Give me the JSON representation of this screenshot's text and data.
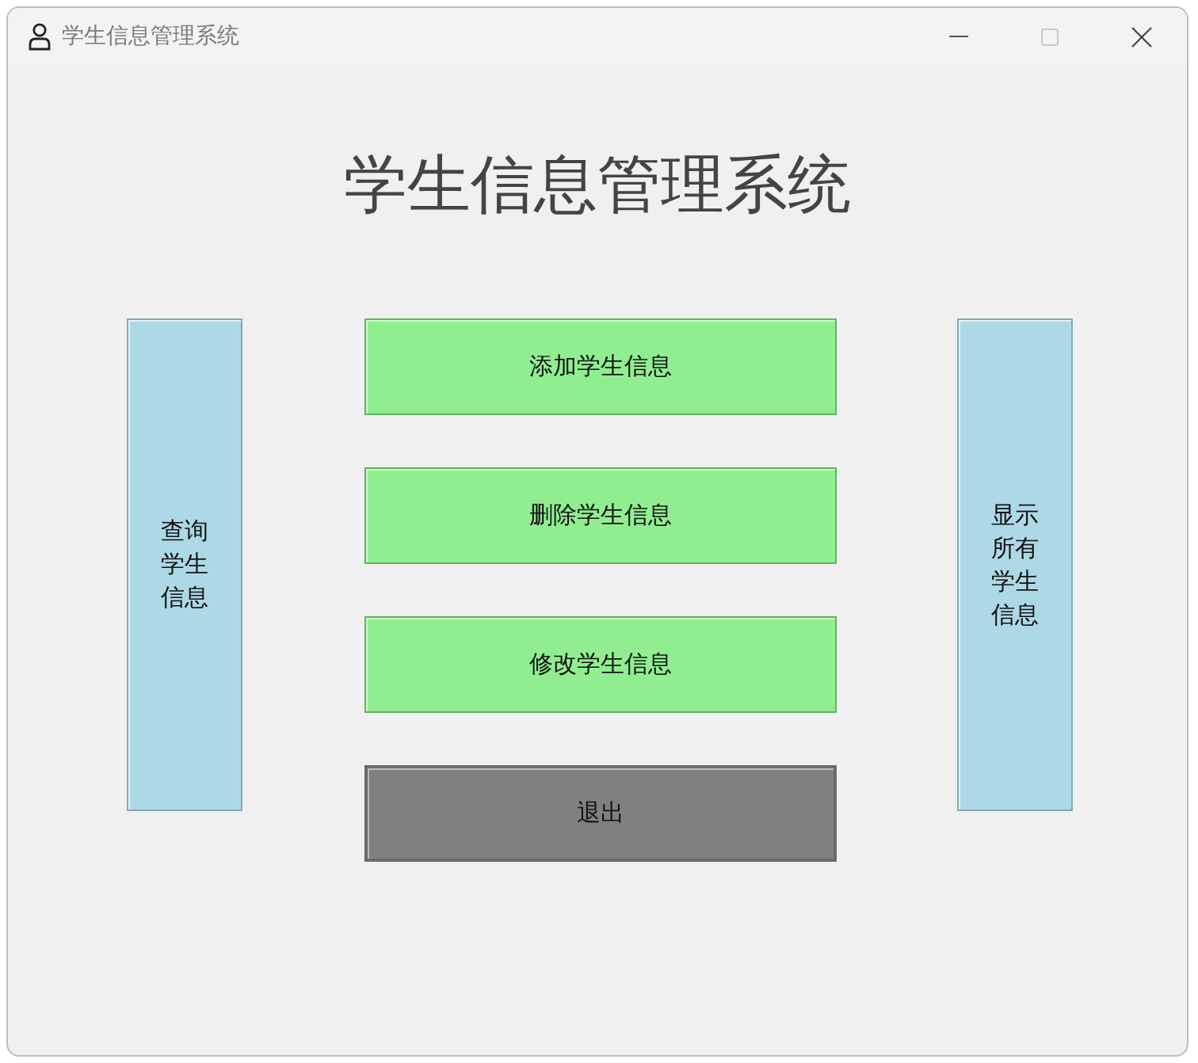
{
  "window": {
    "title": "学生信息管理系统"
  },
  "heading": "学生信息管理系统",
  "left_button": {
    "label": "查询学生信息",
    "kind": "side"
  },
  "center_buttons": [
    {
      "label": "添加学生信息",
      "kind": "action"
    },
    {
      "label": "删除学生信息",
      "kind": "action"
    },
    {
      "label": "修改学生信息",
      "kind": "action"
    },
    {
      "label": "退出",
      "kind": "exit"
    }
  ],
  "right_button": {
    "label": "显示所有学生信息",
    "kind": "side"
  }
}
